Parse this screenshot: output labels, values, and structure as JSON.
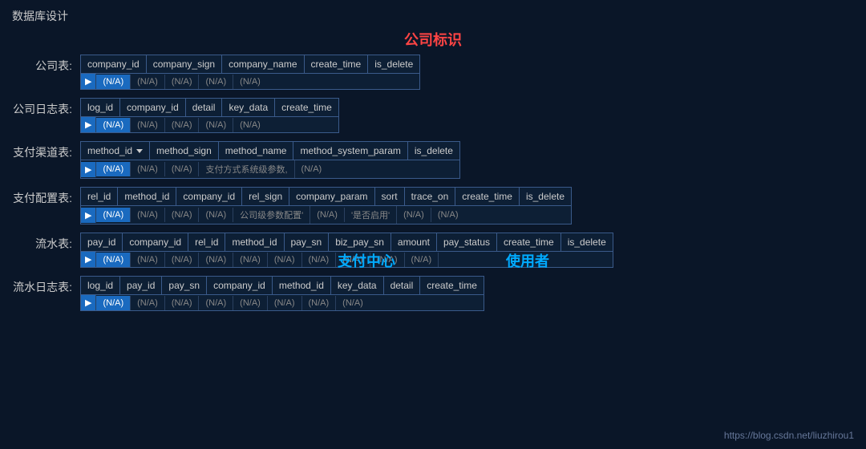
{
  "page": {
    "title": "数据库设计",
    "watermark": "https://blog.csdn.net/liuzhirou1",
    "center_label": "公司标识"
  },
  "tables": [
    {
      "label": "公司表:",
      "columns": [
        "company_id",
        "company_sign",
        "company_name",
        "create_time",
        "is_delete"
      ],
      "row": [
        "(N/A)",
        "(N/A)",
        "(N/A)",
        "(N/A)",
        "(N/A)"
      ],
      "highlighted_col": 0
    },
    {
      "label": "公司日志表:",
      "columns": [
        "log_id",
        "company_id",
        "detail",
        "key_data",
        "create_time"
      ],
      "row": [
        "(N/A)",
        "(N/A)",
        "(N/A)",
        "(N/A)",
        "(N/A)"
      ],
      "highlighted_col": 0
    },
    {
      "label": "支付渠道表:",
      "columns": [
        "method_id",
        "method_sign",
        "method_name",
        "method_system_param",
        "is_delete"
      ],
      "row": [
        "(N/A)",
        "(N/A)",
        "(N/A)",
        "支付方式系统级参数,",
        "(N/A)"
      ],
      "highlighted_col": 0,
      "annotation_col": 3,
      "annotation_text": "支付方式系统级参数,",
      "annotation_color": "red",
      "has_dropdown": 0
    },
    {
      "label": "支付配置表:",
      "columns": [
        "rel_id",
        "method_id",
        "company_id",
        "rel_sign",
        "company_param",
        "sort",
        "trace_on",
        "create_time",
        "is_delete"
      ],
      "row": [
        "(N/A)",
        "(N/A)",
        "(N/A)",
        "(N/A)",
        "公司级参数配置'",
        "(N/A)",
        "'是否启用'",
        "(N/A)",
        "(N/A)"
      ],
      "highlighted_col": 0,
      "annotation_col4": "公司级参数配置'",
      "annotation_col6": "'是否启用'"
    },
    {
      "label": "流水表:",
      "columns": [
        "pay_id",
        "company_id",
        "rel_id",
        "method_id",
        "pay_sn",
        "biz_pay_sn",
        "amount",
        "pay_status",
        "create_time",
        "is_delete"
      ],
      "row": [
        "(N/A)",
        "(N/A)",
        "(N/A)",
        "(N/A)",
        "(N/A)",
        "(N/A)",
        "(N/A)",
        "(N/A)",
        "(N/A)",
        "(N/A)"
      ],
      "highlighted_col": 0,
      "has_center_annotation": true,
      "annotation_left": "支付中心",
      "annotation_right": "使用者"
    },
    {
      "label": "流水日志表:",
      "columns": [
        "log_id",
        "pay_id",
        "pay_sn",
        "company_id",
        "method_id",
        "key_data",
        "detail",
        "create_time"
      ],
      "row": [
        "(N/A)",
        "(N/A)",
        "(N/A)",
        "(N/A)",
        "(N/A)",
        "(N/A)",
        "(N/A)",
        "(N/A)"
      ],
      "highlighted_col": 0
    }
  ]
}
